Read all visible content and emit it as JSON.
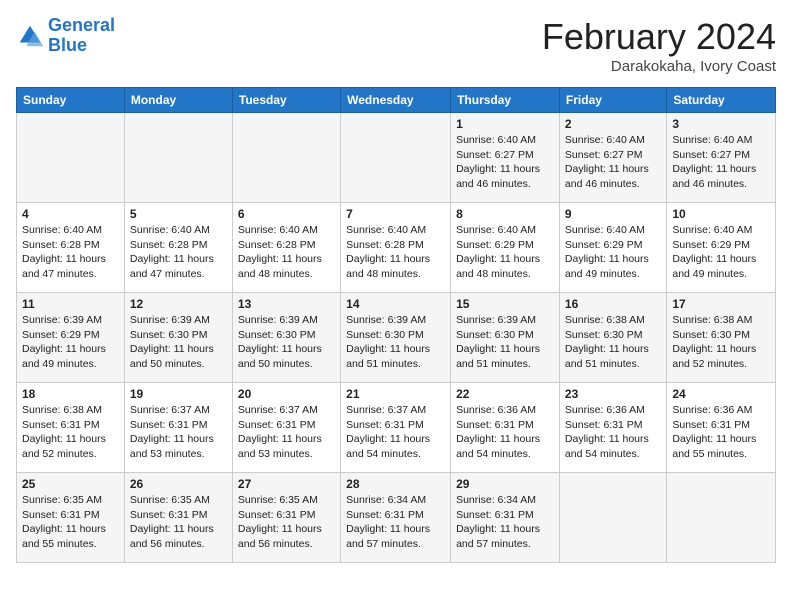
{
  "logo": {
    "line1": "General",
    "line2": "Blue"
  },
  "title": "February 2024",
  "subtitle": "Darakokaha, Ivory Coast",
  "weekdays": [
    "Sunday",
    "Monday",
    "Tuesday",
    "Wednesday",
    "Thursday",
    "Friday",
    "Saturday"
  ],
  "weeks": [
    [
      {
        "day": "",
        "info": ""
      },
      {
        "day": "",
        "info": ""
      },
      {
        "day": "",
        "info": ""
      },
      {
        "day": "",
        "info": ""
      },
      {
        "day": "1",
        "info": "Sunrise: 6:40 AM\nSunset: 6:27 PM\nDaylight: 11 hours\nand 46 minutes."
      },
      {
        "day": "2",
        "info": "Sunrise: 6:40 AM\nSunset: 6:27 PM\nDaylight: 11 hours\nand 46 minutes."
      },
      {
        "day": "3",
        "info": "Sunrise: 6:40 AM\nSunset: 6:27 PM\nDaylight: 11 hours\nand 46 minutes."
      }
    ],
    [
      {
        "day": "4",
        "info": "Sunrise: 6:40 AM\nSunset: 6:28 PM\nDaylight: 11 hours\nand 47 minutes."
      },
      {
        "day": "5",
        "info": "Sunrise: 6:40 AM\nSunset: 6:28 PM\nDaylight: 11 hours\nand 47 minutes."
      },
      {
        "day": "6",
        "info": "Sunrise: 6:40 AM\nSunset: 6:28 PM\nDaylight: 11 hours\nand 48 minutes."
      },
      {
        "day": "7",
        "info": "Sunrise: 6:40 AM\nSunset: 6:28 PM\nDaylight: 11 hours\nand 48 minutes."
      },
      {
        "day": "8",
        "info": "Sunrise: 6:40 AM\nSunset: 6:29 PM\nDaylight: 11 hours\nand 48 minutes."
      },
      {
        "day": "9",
        "info": "Sunrise: 6:40 AM\nSunset: 6:29 PM\nDaylight: 11 hours\nand 49 minutes."
      },
      {
        "day": "10",
        "info": "Sunrise: 6:40 AM\nSunset: 6:29 PM\nDaylight: 11 hours\nand 49 minutes."
      }
    ],
    [
      {
        "day": "11",
        "info": "Sunrise: 6:39 AM\nSunset: 6:29 PM\nDaylight: 11 hours\nand 49 minutes."
      },
      {
        "day": "12",
        "info": "Sunrise: 6:39 AM\nSunset: 6:30 PM\nDaylight: 11 hours\nand 50 minutes."
      },
      {
        "day": "13",
        "info": "Sunrise: 6:39 AM\nSunset: 6:30 PM\nDaylight: 11 hours\nand 50 minutes."
      },
      {
        "day": "14",
        "info": "Sunrise: 6:39 AM\nSunset: 6:30 PM\nDaylight: 11 hours\nand 51 minutes."
      },
      {
        "day": "15",
        "info": "Sunrise: 6:39 AM\nSunset: 6:30 PM\nDaylight: 11 hours\nand 51 minutes."
      },
      {
        "day": "16",
        "info": "Sunrise: 6:38 AM\nSunset: 6:30 PM\nDaylight: 11 hours\nand 51 minutes."
      },
      {
        "day": "17",
        "info": "Sunrise: 6:38 AM\nSunset: 6:30 PM\nDaylight: 11 hours\nand 52 minutes."
      }
    ],
    [
      {
        "day": "18",
        "info": "Sunrise: 6:38 AM\nSunset: 6:31 PM\nDaylight: 11 hours\nand 52 minutes."
      },
      {
        "day": "19",
        "info": "Sunrise: 6:37 AM\nSunset: 6:31 PM\nDaylight: 11 hours\nand 53 minutes."
      },
      {
        "day": "20",
        "info": "Sunrise: 6:37 AM\nSunset: 6:31 PM\nDaylight: 11 hours\nand 53 minutes."
      },
      {
        "day": "21",
        "info": "Sunrise: 6:37 AM\nSunset: 6:31 PM\nDaylight: 11 hours\nand 54 minutes."
      },
      {
        "day": "22",
        "info": "Sunrise: 6:36 AM\nSunset: 6:31 PM\nDaylight: 11 hours\nand 54 minutes."
      },
      {
        "day": "23",
        "info": "Sunrise: 6:36 AM\nSunset: 6:31 PM\nDaylight: 11 hours\nand 54 minutes."
      },
      {
        "day": "24",
        "info": "Sunrise: 6:36 AM\nSunset: 6:31 PM\nDaylight: 11 hours\nand 55 minutes."
      }
    ],
    [
      {
        "day": "25",
        "info": "Sunrise: 6:35 AM\nSunset: 6:31 PM\nDaylight: 11 hours\nand 55 minutes."
      },
      {
        "day": "26",
        "info": "Sunrise: 6:35 AM\nSunset: 6:31 PM\nDaylight: 11 hours\nand 56 minutes."
      },
      {
        "day": "27",
        "info": "Sunrise: 6:35 AM\nSunset: 6:31 PM\nDaylight: 11 hours\nand 56 minutes."
      },
      {
        "day": "28",
        "info": "Sunrise: 6:34 AM\nSunset: 6:31 PM\nDaylight: 11 hours\nand 57 minutes."
      },
      {
        "day": "29",
        "info": "Sunrise: 6:34 AM\nSunset: 6:31 PM\nDaylight: 11 hours\nand 57 minutes."
      },
      {
        "day": "",
        "info": ""
      },
      {
        "day": "",
        "info": ""
      }
    ]
  ]
}
